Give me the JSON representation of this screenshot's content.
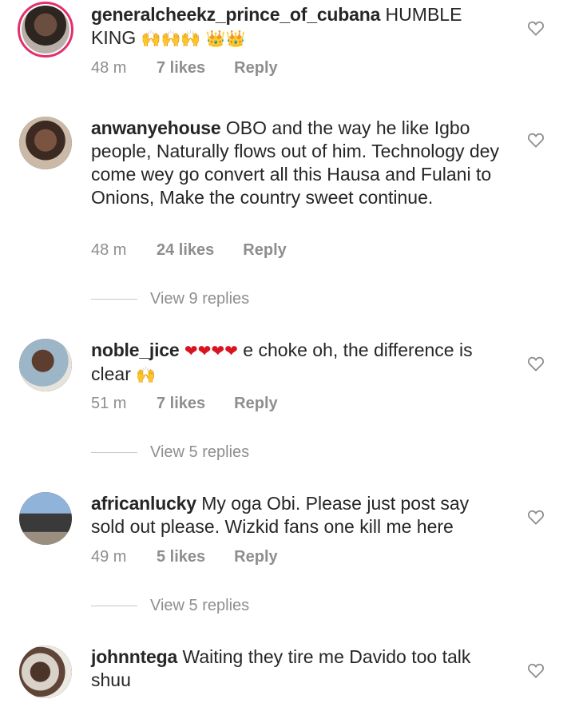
{
  "comments": [
    {
      "username": "generalcheekz_prince_of_cubana",
      "text_before": " HUMBLE KING ",
      "emoji_1": "🙌🙌🙌",
      "emoji_2": "👑👑",
      "text_after": "",
      "time": "48 m",
      "likes": "7 likes",
      "reply": "Reply"
    },
    {
      "username": "anwanyehouse",
      "text_before": " OBO and the way he like Igbo people, Naturally flows out of him. Technology dey come wey go convert all this Hausa and Fulani to Onions, Make the country sweet continue.",
      "time": "48 m",
      "likes": "24 likes",
      "reply": "Reply",
      "view_replies": "View 9 replies"
    },
    {
      "username": "noble_jice",
      "emoji_1": "❤❤❤❤",
      "text_before": " e choke oh, the difference  is clear ",
      "emoji_2": "🙌",
      "time": "51 m",
      "likes": "7 likes",
      "reply": "Reply",
      "view_replies": "View 5 replies"
    },
    {
      "username": "africanlucky",
      "text_before": " My oga Obi. Please just post say sold out please. Wizkid fans one kill me here",
      "time": "49 m",
      "likes": "5 likes",
      "reply": "Reply",
      "view_replies": "View 5 replies"
    },
    {
      "username": "johnntega",
      "text_before": " Waiting they tire me Davido too talk shuu"
    }
  ],
  "icons": {
    "like": "heart-outline-icon",
    "avatar": "profile-photo"
  },
  "colors": {
    "text": "#262626",
    "meta": "#8e8e8e",
    "story_ring": "#e1306c"
  }
}
